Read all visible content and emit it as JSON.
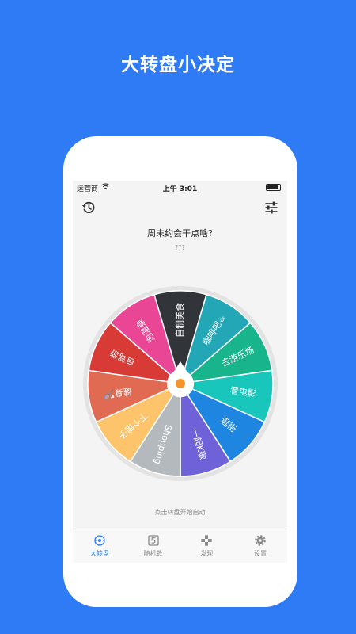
{
  "promo": {
    "title": "大转盘小决定"
  },
  "status": {
    "carrier": "运营商",
    "time": "上午 3:01"
  },
  "main": {
    "question": "周末约会干点啥?",
    "subtitle": "???",
    "hint": "点击转盘开始启动"
  },
  "wheel": {
    "segments": [
      {
        "label": "泡温泉",
        "color": "#e94796"
      },
      {
        "label": "自制美食",
        "color": "#31353a"
      },
      {
        "label": "咖啡吧☕",
        "color": "#23a6b6"
      },
      {
        "label": "去游乐场",
        "color": "#18b48c"
      },
      {
        "label": "看电影",
        "color": "#19c6bb"
      },
      {
        "label": "逛街",
        "color": "#1e86e1"
      },
      {
        "label": "一起K歌",
        "color": "#6f62d9"
      },
      {
        "label": "Shopping",
        "color": "#b4b9bd"
      },
      {
        "label": "下个馆子",
        "color": "#fdc46c"
      },
      {
        "label": "健身🏸",
        "color": "#e06a52"
      },
      {
        "label": "自驾游",
        "color": "#d83a35"
      }
    ],
    "pointer_color": "#f3952a"
  },
  "tabs": [
    {
      "label": "大转盘",
      "icon": "wheel-icon",
      "active": true
    },
    {
      "label": "随机数",
      "icon": "number-five-icon",
      "active": false
    },
    {
      "label": "发现",
      "icon": "gamepad-icon",
      "active": false
    },
    {
      "label": "设置",
      "icon": "gear-icon",
      "active": false
    }
  ],
  "colors": {
    "background": "#2f7bf6",
    "accent": "#2f7bf6"
  }
}
